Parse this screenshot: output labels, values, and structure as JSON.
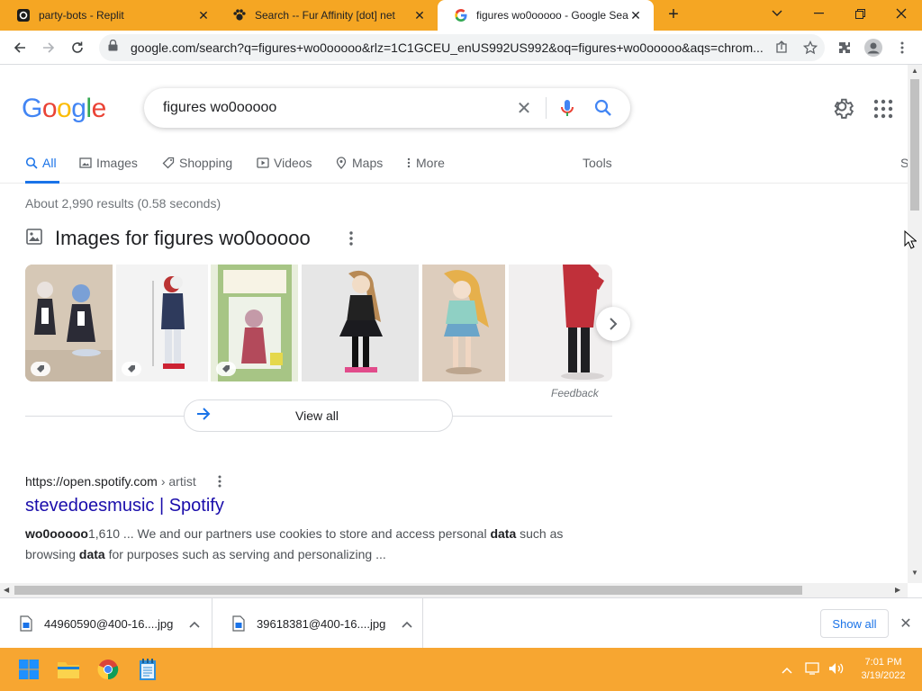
{
  "browser": {
    "tabs": [
      {
        "title": "party-bots - Replit",
        "favicon": "replit-icon",
        "active": false
      },
      {
        "title": "Search -- Fur Affinity [dot] net",
        "favicon": "paw-icon",
        "active": false
      },
      {
        "title": "figures wo0ooooo - Google Sear",
        "favicon": "google-g-icon",
        "active": true
      }
    ],
    "new_tab_label": "+",
    "url": "google.com/search?q=figures+wo0ooooo&rlz=1C1GCEU_enUS992US992&oq=figures+wo0ooooo&aqs=chrom..."
  },
  "google": {
    "logo": [
      "G",
      "o",
      "o",
      "g",
      "l",
      "e"
    ],
    "logo_colors": [
      "#4285f4",
      "#ea4335",
      "#fbbc05",
      "#4285f4",
      "#34a853",
      "#ea4335"
    ],
    "query": "figures wo0ooooo",
    "nav_tabs": [
      {
        "label": "All",
        "icon": "search-icon",
        "active": true
      },
      {
        "label": "Images",
        "icon": "image-icon",
        "active": false
      },
      {
        "label": "Shopping",
        "icon": "tag-icon",
        "active": false
      },
      {
        "label": "Videos",
        "icon": "play-icon",
        "active": false
      },
      {
        "label": "Maps",
        "icon": "pin-icon",
        "active": false
      },
      {
        "label": "More",
        "icon": "more-vert-icon",
        "active": false
      }
    ],
    "tools_label": "Tools",
    "cut_off_tab": "S",
    "result_stats": "About 2,990 results (0.58 seconds)",
    "images_heading": "Images for figures wo0ooooo",
    "feedback_label": "Feedback",
    "view_all_label": "View all",
    "thumbnails": [
      {
        "desc": "two anime maid figures",
        "bg": "#d6c8b6",
        "tag": true
      },
      {
        "desc": "figure with red and white hair",
        "bg": "#f2f2f2",
        "tag": true
      },
      {
        "desc": "boxed figure",
        "bg": "#a9c58a",
        "tag": true
      },
      {
        "desc": "figure in black skirt",
        "bg": "#e4e4e4",
        "tag": false
      },
      {
        "desc": "figure with blonde hair",
        "bg": "#d9c7b3",
        "tag": false
      },
      {
        "desc": "figure in red outfit",
        "bg": "#f0eeee",
        "tag": false
      }
    ],
    "result": {
      "cite_domain": "https://open.spotify.com",
      "cite_path": "› artist",
      "title": "stevedoesmusic | Spotify",
      "snippet_bold1": "wo0ooooo",
      "snippet_1": "1,610 ... We and our partners use cookies to store and access personal ",
      "snippet_bold2": "data",
      "snippet_2": " such as browsing ",
      "snippet_bold3": "data",
      "snippet_3": " for purposes such as serving and personalizing ..."
    }
  },
  "downloads": {
    "items": [
      {
        "name": "44960590@400-16....jpg"
      },
      {
        "name": "39618381@400-16....jpg"
      }
    ],
    "show_all_label": "Show all"
  },
  "taskbar": {
    "time": "7:01 PM",
    "date": "3/19/2022"
  }
}
